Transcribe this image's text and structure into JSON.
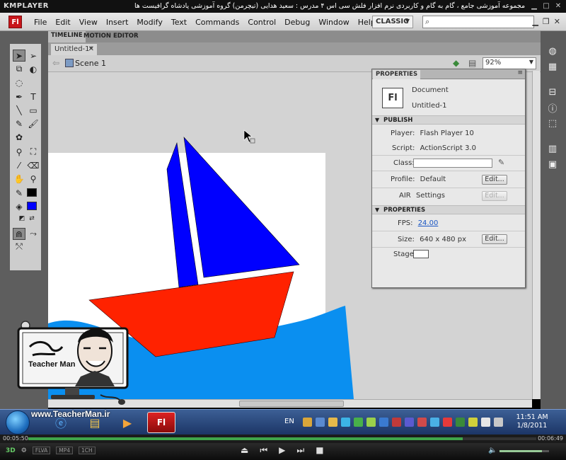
{
  "player": {
    "logo": "KMPLAYER",
    "caption": "مجموعه آموزشی جامع ، گام به گام و کاربردی نرم افزار فلش سی اس ۴ مدرس : سعید هدایی (تیچرمن) گروه آموزشی پادشاه گرافیست ها",
    "time_elapsed": "00:05:50",
    "time_total": "00:06:49",
    "progress": 0.855,
    "volume": 0.85,
    "badges": [
      "FLVA",
      "MP4",
      "1CH"
    ]
  },
  "menu": {
    "app_logo": "Fl",
    "items": [
      "File",
      "Edit",
      "View",
      "Insert",
      "Modify",
      "Text",
      "Commands",
      "Control",
      "Debug",
      "Window",
      "Help"
    ],
    "workspace": "CLASSIC",
    "search_icon": "search-icon"
  },
  "timeline": {
    "tab_timeline": "TIMELINE",
    "tab_motion": "MOTION EDITOR",
    "doc_tab": "Untitled-1*",
    "scene": "Scene 1",
    "zoom": "92%"
  },
  "properties": {
    "panel_title": "PROPERTIES",
    "doc_icon": "Fl",
    "doc_type": "Document",
    "doc_name": "Untitled-1",
    "publish_header": "PUBLISH",
    "player_label": "Player:",
    "player_value": "Flash Player 10",
    "script_label": "Script:",
    "script_value": "ActionScript 3.0",
    "class_label": "Class:",
    "profile_label": "Profile:",
    "profile_value": "Default",
    "edit": "Edit...",
    "air_label": "AIR",
    "air_value": "Settings",
    "properties_header": "PROPERTIES",
    "fps_label": "FPS:",
    "fps_value": "24.00",
    "size_label": "Size:",
    "size_value": "640 x 480 px",
    "stage_label": "Stage:"
  },
  "stage": {
    "sail_color": "#0000ff",
    "hull_color": "#ff2200",
    "water_color": "#0a8ff0",
    "stage_color": "#ffffff"
  },
  "taskbar": {
    "lang": "EN",
    "time": "11:51 AM",
    "date": "1/8/2011",
    "flash_btn": "Fl"
  },
  "overlay": {
    "url": "www.TeacherMan.ir",
    "brand": "Teacher Man"
  }
}
